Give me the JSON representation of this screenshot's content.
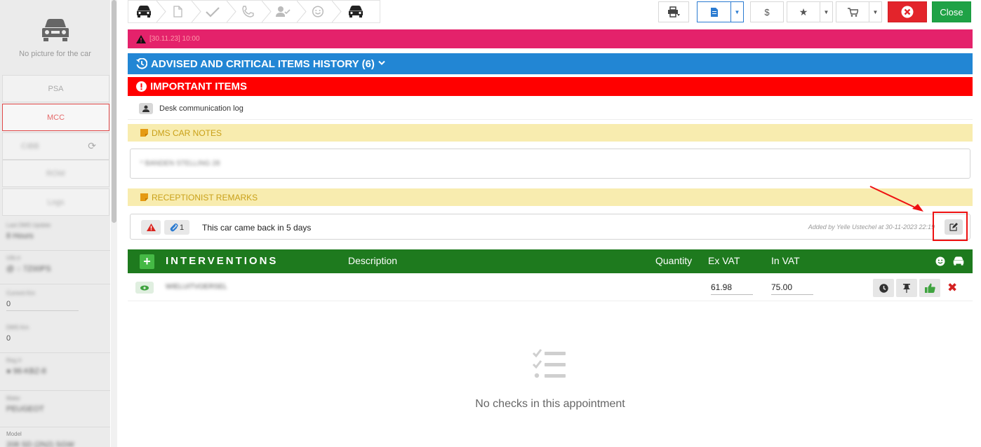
{
  "sidebar": {
    "no_picture": "No picture for the car",
    "buttons": {
      "psa": "PSA",
      "mcc": "MCC",
      "code": "CIBB",
      "row": "ROW",
      "logs": "Logs"
    },
    "fields": [
      {
        "label": "Last DMS Update",
        "value": "8 Hours"
      },
      {
        "label": "VIN #",
        "value": "@ ◌ 7Z00PS"
      },
      {
        "label": "Current Km",
        "value": "0"
      },
      {
        "label": "DMS Km",
        "value": "0"
      },
      {
        "label": "Reg #",
        "value": "● 96-KBZ-8"
      },
      {
        "label": "Make",
        "value": "PEUGEOT"
      },
      {
        "label": "Model",
        "value": "208 SD (2N2) SGW"
      }
    ]
  },
  "toolbar": {
    "close_label": "Close",
    "currency_label": "$"
  },
  "alert": {
    "text": "[30.11.23] 10:00"
  },
  "history": {
    "title": "ADVISED AND CRITICAL ITEMS HISTORY (6)"
  },
  "important": {
    "title": "IMPORTANT ITEMS"
  },
  "desk_log": {
    "label": "Desk communication log"
  },
  "dms_notes": {
    "title": "DMS CAR NOTES",
    "text": "* BANDEN STELLING 28"
  },
  "receptionist": {
    "title": "RECEPTIONIST REMARKS",
    "attach_count": "1",
    "remark": "This car came back in 5 days",
    "added_by": "Added by Yelle Ustechel at 30-11-2023 22:19"
  },
  "interventions": {
    "title": "INTERVENTIONS",
    "col_description": "Description",
    "col_quantity": "Quantity",
    "col_ex_vat": "Ex VAT",
    "col_in_vat": "In VAT",
    "rows": [
      {
        "description": "WIELUITVOERSEL",
        "ex_vat": "61.98",
        "in_vat": "75.00"
      }
    ]
  },
  "empty_state": {
    "message": "No checks in this appointment"
  },
  "colors": {
    "alert_pink": "#e4226b",
    "history_blue": "#2286d4",
    "important_red": "#ff0000",
    "interventions_green": "#1e7a1e",
    "note_yellow": "#f8ecaf",
    "close_green": "#1fa246"
  }
}
